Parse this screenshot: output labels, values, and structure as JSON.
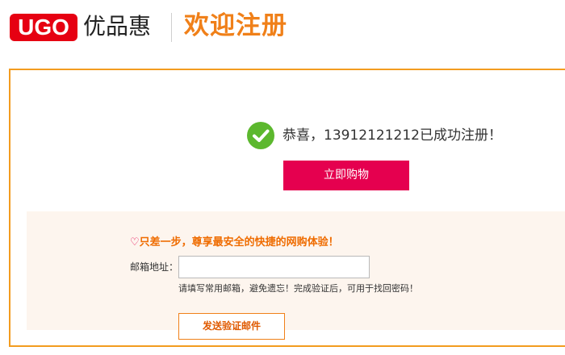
{
  "header": {
    "logo_text": "UGO",
    "brand_name": "优品惠",
    "page_title": "欢迎注册",
    "brand_color": "#e60012",
    "title_color": "#f08019"
  },
  "success": {
    "icon": "check-circle-icon",
    "icon_color": "#5cb82e",
    "message": "恭喜，13912121212已成功注册！"
  },
  "shop_button": {
    "label": "立即购物",
    "color": "#e5004f"
  },
  "verify": {
    "heart_icon": "♡",
    "heading": "只差一步，尊享最安全的快捷的网购体验！",
    "email_label": "邮箱地址：",
    "email_value": "",
    "email_placeholder": "",
    "hint": "请填写常用邮箱，避免遗忘！完成验证后，可用于找回密码！",
    "send_button_label": "发送验证邮件",
    "accent_color": "#f08019"
  }
}
